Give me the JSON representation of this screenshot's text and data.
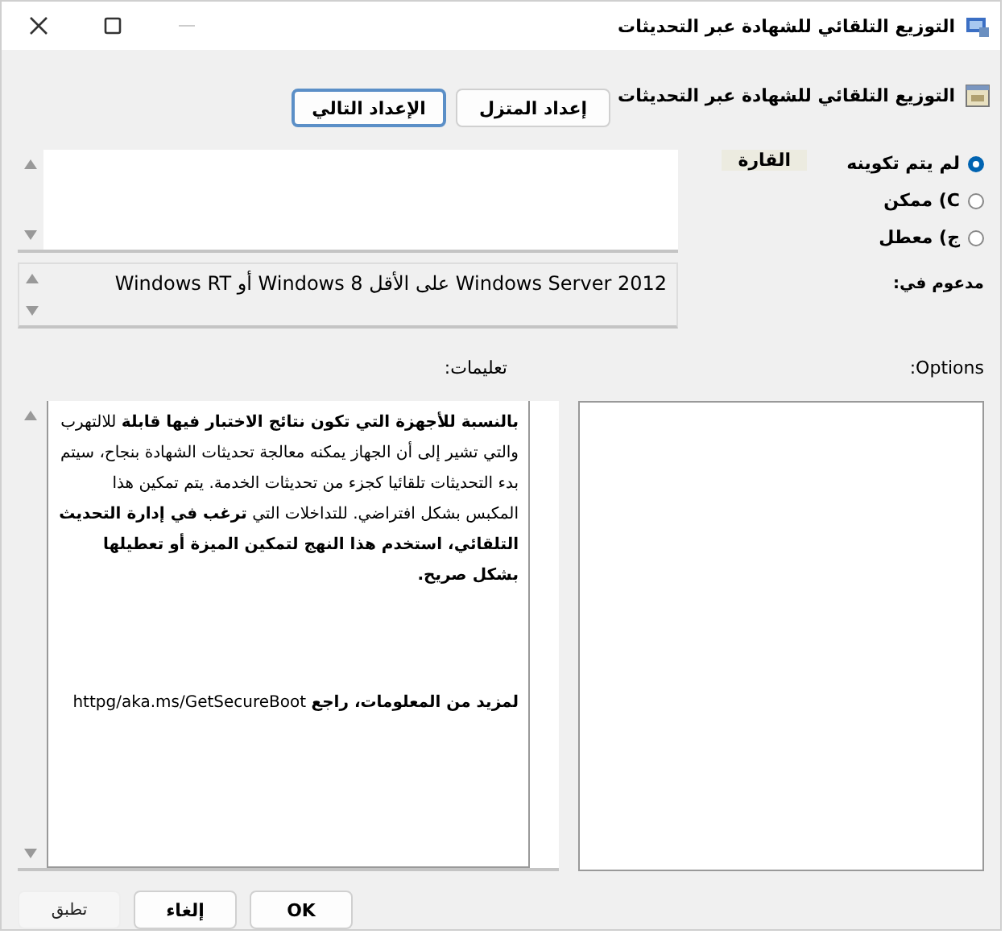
{
  "window": {
    "title": "التوزيع التلقائي للشهادة عبر التحديثات"
  },
  "policy": {
    "title": "التوزيع التلقائي للشهادة عبر التحديثات"
  },
  "nav_buttons": [
    {
      "label": "إعداد المتزل",
      "focused": false
    },
    {
      "label": "الإعداد التالي",
      "focused": true
    }
  ],
  "states": [
    {
      "label": "لم يتم تكوينه",
      "selected": true
    },
    {
      "label": "C) ممكن",
      "selected": false
    },
    {
      "label": "ج) معطل",
      "selected": false
    }
  ],
  "comment": {
    "label": "القارة"
  },
  "supported": {
    "label": "مدعوم في:",
    "value": "Windows Server 2012 على الأقل Windows 8 أو Windows RT"
  },
  "options": {
    "label": "Options:"
  },
  "help": {
    "label": "تعليمات:",
    "paragraphs": [
      "**بالنسبة للأجهزة التي تكون نتائج الاختبار فيها قابلة** للالتهرب والتي تشير إلى أن الجهاز يمكنه معالجة تحديثات الشهادة بنجاح، سيتم بدء التحديثات تلقائيا كجزء من تحديثات الخدمة. يتم تمكين هذا المكبس بشكل افتراضي. للتداخلات التي **ترغب في إدارة التحديث التلقائي، استخدم هذا النهج لتمكين الميزة أو تعطيلها بشكل صريح.**",
      "**لمزيد من المعلومات، راجع** httpg/aka.ms/GetSecureBoot"
    ]
  },
  "footer_buttons": [
    {
      "label": "OK",
      "disabled": false
    },
    {
      "label": "إلغاء",
      "disabled": false
    },
    {
      "label": "تطبق",
      "disabled": true
    }
  ]
}
